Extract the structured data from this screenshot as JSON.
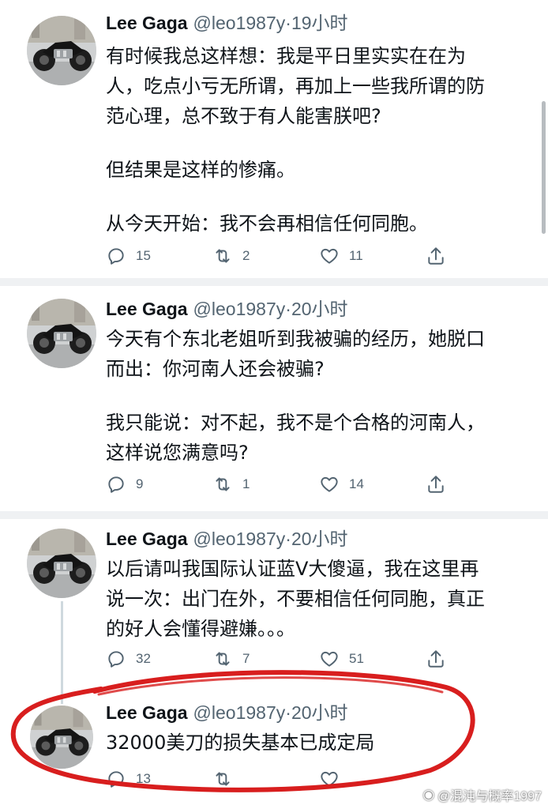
{
  "tweets": [
    {
      "name": "Lee Gaga",
      "handle": "@leo1987y",
      "dot": "·",
      "time": "19小时",
      "lines": [
        "有时候我总这样想：我是平日里实实在在为",
        "人，吃点小亏无所谓，再加上一些我所谓的防",
        "范心理，总不致于有人能害朕吧?",
        "但结果是这样的惨痛。",
        "从今天开始：我不会再相信任何同胞。"
      ],
      "replies": "15",
      "retweets": "2",
      "likes": "11"
    },
    {
      "name": "Lee Gaga",
      "handle": "@leo1987y",
      "dot": "·",
      "time": "20小时",
      "lines": [
        "今天有个东北老姐听到我被骗的经历，她脱口",
        "而出：你河南人还会被骗?",
        "我只能说：对不起，我不是个合格的河南人，",
        "这样说您满意吗?"
      ],
      "replies": "9",
      "retweets": "1",
      "likes": "14"
    },
    {
      "name": "Lee Gaga",
      "handle": "@leo1987y",
      "dot": "·",
      "time": "20小时",
      "lines": [
        "以后请叫我国际认证蓝V大傻逼，我在这里再",
        "说一次：出门在外，不要相信任何同胞，真正",
        "的好人会懂得避嫌。。。"
      ],
      "replies": "32",
      "retweets": "7",
      "likes": "51"
    },
    {
      "name": "Lee Gaga",
      "handle": "@leo1987y",
      "dot": "·",
      "time": "20小时",
      "lines": [
        "32000美刀的损失基本已成定局"
      ],
      "replies": "13",
      "retweets": "",
      "likes": ""
    }
  ],
  "icons": {
    "reply": "reply-icon",
    "retweet": "retweet-icon",
    "like": "heart-icon",
    "share": "share-icon"
  },
  "colors": {
    "text": "#0f1419",
    "muted": "#536471",
    "separator": "#eff1f3",
    "annotation": "#d81e1e"
  },
  "watermark": {
    "text": "@混沌与概率1997"
  }
}
